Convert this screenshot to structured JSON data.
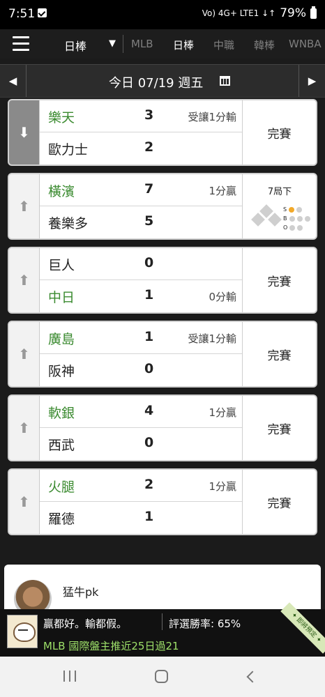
{
  "status_bar": {
    "time": "7:51",
    "indicators": "Vo) 4G+ LTE1 ↓↑",
    "battery": "79%"
  },
  "nav": {
    "league_select": "日棒",
    "tabs": [
      "MLB",
      "日棒",
      "中職",
      "韓棒",
      "WNBA"
    ],
    "active_tab": "日棒"
  },
  "date_bar": {
    "label": "今日 07/19 週五"
  },
  "games": [
    {
      "vote": "down",
      "team1": "樂天",
      "score1": "3",
      "note1": "受讓1分輸",
      "team2": "歐力士",
      "score2": "2",
      "note2": "",
      "status": "完賽"
    },
    {
      "vote": "up",
      "team1": "橫濱",
      "score1": "7",
      "note1": "1分贏",
      "team2": "養樂多",
      "score2": "5",
      "note2": "",
      "status": "",
      "live": {
        "inning": "7局下",
        "s_label": "S",
        "b_label": "B",
        "o_label": "O",
        "strikes": 1,
        "balls": 0,
        "outs": 0
      }
    },
    {
      "vote": "up",
      "team1": "巨人",
      "score1": "0",
      "note1": "",
      "team2": "中日",
      "score2": "1",
      "note2": "0分輸",
      "status": "完賽"
    },
    {
      "vote": "up",
      "team1": "廣島",
      "score1": "1",
      "note1": "受讓1分輸",
      "team2": "阪神",
      "score2": "0",
      "note2": "",
      "status": "完賽"
    },
    {
      "vote": "up",
      "team1": "軟銀",
      "score1": "4",
      "note1": "1分贏",
      "team2": "西武",
      "score2": "0",
      "note2": "",
      "status": "完賽"
    },
    {
      "vote": "up",
      "team1": "火腿",
      "score1": "2",
      "note1": "1分贏",
      "team2": "羅德",
      "score2": "1",
      "note2": "",
      "status": "完賽"
    }
  ],
  "post": {
    "username": "猛牛pk"
  },
  "banner": {
    "slogan": "贏都好。輸都假。",
    "winrate": "評選勝率: 65%",
    "promo": "MLB 國際盤主推近25日過21",
    "ribbon": "✦ 即將預定 ✦"
  },
  "colors": {
    "accent_green": "#3a8a2f",
    "promo_green": "#9fe26a",
    "base_on": "#f2a92a"
  }
}
